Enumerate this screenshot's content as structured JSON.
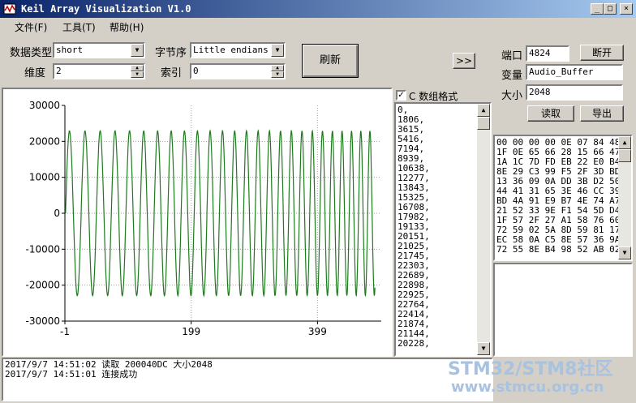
{
  "window": {
    "title": "Keil Array Visualization V1.0",
    "minimize": "_",
    "maximize": "□",
    "close": "×"
  },
  "menu": [
    "文件(F)",
    "工具(T)",
    "帮助(H)"
  ],
  "controls": {
    "data_type_label": "数据类型",
    "data_type_value": "short",
    "byte_order_label": "字节序",
    "byte_order_value": "Little endians",
    "dimension_label": "维度",
    "dimension_value": "2",
    "index_label": "索引",
    "index_value": "0",
    "refresh_label": "刷新",
    "expand_label": ">>",
    "port_label": "端口",
    "port_value": "4824",
    "disconnect_label": "断开",
    "variable_label": "变量",
    "variable_value": "Audio_Buffer",
    "size_label": "大小",
    "size_value": "2048",
    "read_label": "读取",
    "export_label": "导出"
  },
  "array_panel": {
    "checkbox_label": "C 数组格式",
    "checked": true,
    "values": [
      "0,",
      "1806,",
      "3615,",
      "5416,",
      "7194,",
      "8939,",
      "10638,",
      "12277,",
      "13843,",
      "15325,",
      "16708,",
      "17982,",
      "19133,",
      "20151,",
      "21025,",
      "21745,",
      "22303,",
      "22689,",
      "22898,",
      "22925,",
      "22764,",
      "22414,",
      "21874,",
      "21144,",
      "20228,"
    ]
  },
  "hex_dump": [
    "00 00 00 00 0E 07 84 48",
    "1F 0E 65 66 28 15 66 47",
    "1A 1C 7D FD EB 22 E0 B4",
    "8E 29 C3 99 F5 2F 3D BD",
    "13 36 09 0A DD 3B D2 50",
    "44 41 31 65 3E 46 CC 39",
    "BD 4A 91 E9 B7 4E 74 A7",
    "21 52 33 9E F1 54 5D D4",
    "1F 57 2F 27 A1 58 76 60",
    "72 59 02 5A 8D 59 81 17",
    "EC 58 0A C5 8E 57 36 9A",
    "72 55 8E B4 98 52 AB 02"
  ],
  "log": [
    "2017/9/7 14:51:02 读取 200040DC 大小2048",
    "2017/9/7 14:51:01 连接成功"
  ],
  "watermark": {
    "line1": "STM32/STM8社区",
    "line2": "www.stmcu.org.cn"
  },
  "chart_data": {
    "type": "line",
    "title": "",
    "xlabel": "",
    "ylabel": "",
    "xlim": [
      -1,
      500
    ],
    "ylim": [
      -30000,
      30000
    ],
    "x_ticks": [
      "-1",
      "199",
      "399"
    ],
    "x_tick_values": [
      -1,
      199,
      399
    ],
    "y_ticks": [
      "30000",
      "20000",
      "10000",
      "0",
      "-10000",
      "-20000",
      "-30000"
    ],
    "y_tick_values": [
      30000,
      20000,
      10000,
      0,
      -10000,
      -20000,
      -30000
    ],
    "grid": true,
    "series": [
      {
        "color": "#1f7a1f",
        "signal": "chirp sine",
        "amplitude": 22925,
        "start_x": 0,
        "end_x": 490,
        "start_period": 25,
        "end_period": 14
      }
    ]
  }
}
